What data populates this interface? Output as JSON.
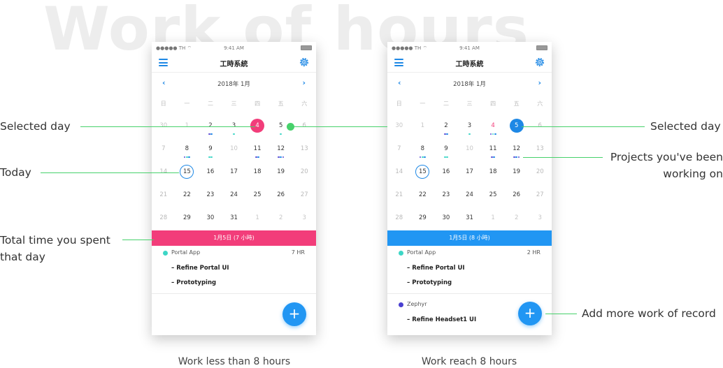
{
  "background_title": "Work of hours",
  "screens": [
    {
      "status": {
        "carrier": "●●●●● TH ⌔",
        "time": "9:41 AM"
      },
      "nav_title": "工時系統",
      "month_label": "2018年 1月",
      "weekdays": [
        "日",
        "一",
        "二",
        "三",
        "四",
        "五",
        "六"
      ],
      "day_band": "1月5日 (7 小時)",
      "projects": [
        {
          "name": "Portal App",
          "hours": "7 HR",
          "color": "#3dd6c6",
          "tasks": [
            "– Refine Portal UI",
            "– Prototyping"
          ]
        }
      ],
      "fab_label": "+"
    },
    {
      "status": {
        "carrier": "●●●●● TH ⌔",
        "time": "9:41 AM"
      },
      "nav_title": "工時系統",
      "month_label": "2018年 1月",
      "weekdays": [
        "日",
        "一",
        "二",
        "三",
        "四",
        "五",
        "六"
      ],
      "day_band": "1月5日 (8 小時)",
      "projects": [
        {
          "name": "Portal App",
          "hours": "2 HR",
          "color": "#3dd6c6",
          "tasks": [
            "– Refine Portal UI",
            "– Prototyping"
          ]
        },
        {
          "name": "Zephyr",
          "hours": "",
          "color": "#4a3fd0",
          "tasks": [
            "– Refine Headset1 UI"
          ]
        }
      ],
      "fab_label": "+"
    }
  ],
  "calendar_rows": [
    [
      "30",
      "1",
      "2",
      "3",
      "4",
      "5",
      "6"
    ],
    [
      "7",
      "8",
      "9",
      "10",
      "11",
      "12",
      "13"
    ],
    [
      "14",
      "15",
      "16",
      "17",
      "18",
      "19",
      "20"
    ],
    [
      "21",
      "22",
      "23",
      "24",
      "25",
      "26",
      "27"
    ],
    [
      "28",
      "29",
      "30",
      "31",
      "1",
      "2",
      "3"
    ]
  ],
  "annotations": {
    "selected_day_left": "Selected day",
    "today": "Today",
    "total_time": "Total time you spent that day",
    "selected_day_right": "Selected day",
    "projects": "Projects you've been working on",
    "add_more": "Add more work of record"
  },
  "captions": {
    "left": "Work less than 8 hours",
    "right": "Work reach 8 hours"
  },
  "colors": {
    "pink": "#f23d7a",
    "blue": "#2196f3",
    "teal": "#3dd6c6",
    "purple": "#5b4fd6",
    "guide_green": "#47d16b"
  }
}
